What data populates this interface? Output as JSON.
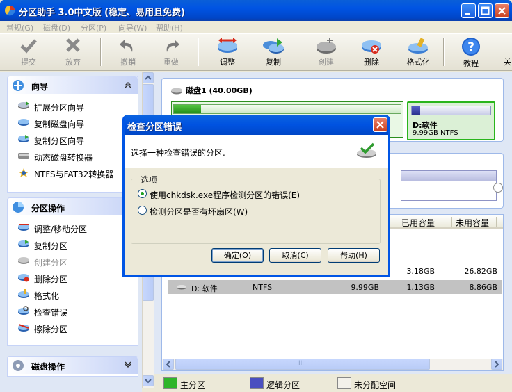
{
  "window": {
    "title": "分区助手 3.0中文版 (稳定、易用且免费)"
  },
  "menu": [
    "常规(G)",
    "磁盘(D)",
    "分区(P)",
    "向导(W)",
    "帮助(H)"
  ],
  "toolbar": {
    "buttons": [
      {
        "label": "提交",
        "icon": "check-icon"
      },
      {
        "label": "放弃",
        "icon": "x-icon"
      },
      {
        "label": "撤销",
        "icon": "undo-icon"
      },
      {
        "label": "重做",
        "icon": "redo-icon"
      },
      {
        "label": "调整",
        "icon": "resize-disk-icon"
      },
      {
        "label": "复制",
        "icon": "copy-disk-icon"
      },
      {
        "label": "创建",
        "icon": "create-disk-icon"
      },
      {
        "label": "删除",
        "icon": "delete-disk-icon"
      },
      {
        "label": "格式化",
        "icon": "format-icon"
      },
      {
        "label": "教程",
        "icon": "help-icon"
      },
      {
        "label": "关"
      }
    ]
  },
  "sidebar": {
    "wizard": {
      "title": "向导",
      "items": [
        "扩展分区向导",
        "复制磁盘向导",
        "复制分区向导",
        "动态磁盘转换器",
        "NTFS与FAT32转换器"
      ]
    },
    "partition_ops": {
      "title": "分区操作",
      "items": [
        "调整/移动分区",
        "复制分区",
        "创建分区",
        "删除分区",
        "格式化",
        "检查错误",
        "擦除分区"
      ]
    },
    "disk_ops": {
      "title": "磁盘操作"
    }
  },
  "disk": {
    "title": "磁盘1 (40.00GB)",
    "c_used_fraction": 0.12,
    "d_name": "D:软件",
    "d_info": "9.99GB NTFS",
    "d_used_fraction": 0.11
  },
  "table": {
    "headers": {
      "used": "已用容量",
      "free": "未用容量"
    },
    "rows": [
      {
        "name": "",
        "fs": "",
        "capacity": "",
        "used": "3.18GB",
        "free": "26.82GB"
      },
      {
        "name": "D: 软件",
        "fs": "NTFS",
        "capacity": "9.99GB",
        "used": "1.13GB",
        "free": "8.86GB"
      }
    ],
    "scroll_mark": "III"
  },
  "legend": {
    "primary": "主分区",
    "logical": "逻辑分区",
    "unallocated": "未分配空间",
    "colors": {
      "primary": "#2fb52a",
      "logical": "#4a4fc0",
      "unallocated": "#f3f1ea"
    }
  },
  "dialog": {
    "title": "检查分区错误",
    "prompt": "选择一种检查错误的分区.",
    "group_label": "选项",
    "option1": "使用chkdsk.exe程序检测分区的错误(E)",
    "option2": "检测分区是否有坏扇区(W)",
    "selected_option": 1,
    "ok": "确定(O)",
    "cancel": "取消(C)",
    "help": "帮助(H)"
  }
}
